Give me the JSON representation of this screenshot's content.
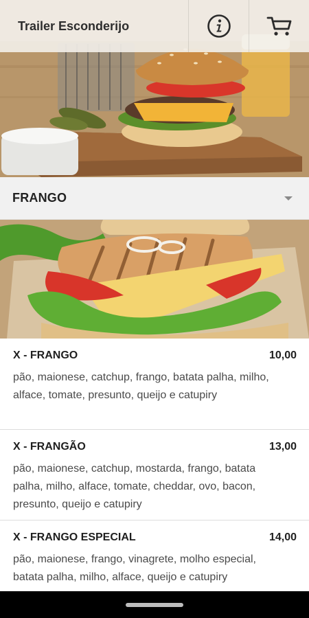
{
  "header": {
    "title": "Trailer Esconderijo",
    "info_icon": "info-circle-icon",
    "cart_icon": "shopping-cart-icon"
  },
  "category": {
    "name": "FRANGO",
    "dropdown_icon": "caret-down-icon"
  },
  "menu": {
    "items": [
      {
        "name": "X - FRANGO",
        "price": "10,00",
        "description": "pão, maionese, catchup, frango, batata palha, milho, alface, tomate, presunto, queijo e catupiry"
      },
      {
        "name": "X - FRANGÃO",
        "price": "13,00",
        "description": "pão, maionese, catchup, mostarda, frango, batata palha, milho, alface, tomate, cheddar, ovo, bacon, presunto, queijo e catupiry"
      },
      {
        "name": "X - FRANGO ESPECIAL",
        "price": "14,00",
        "description": "pão, maionese, frango, vinagrete, molho especial, batata palha, milho, alface, queijo e catupiry"
      }
    ]
  },
  "colors": {
    "header_bg": "#f3f0ea",
    "category_bg": "#f1f1f1",
    "text": "#222222",
    "nav_bar": "#000000"
  }
}
